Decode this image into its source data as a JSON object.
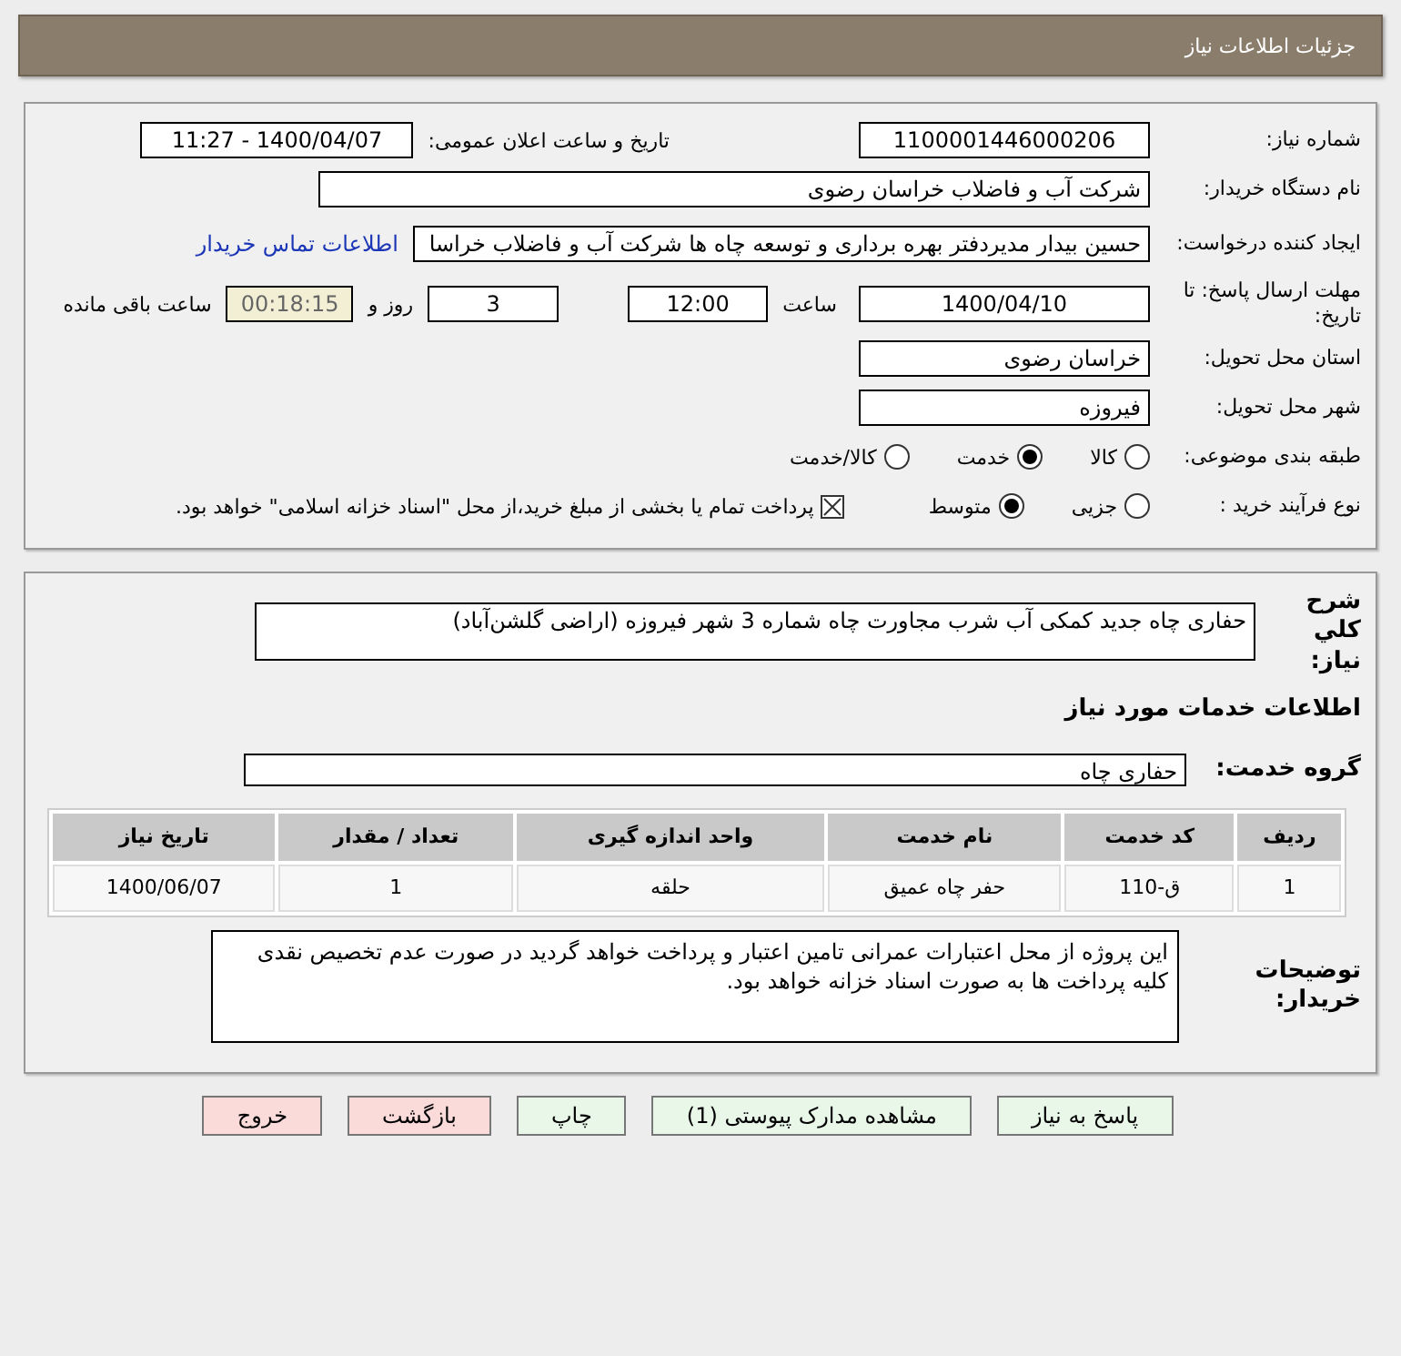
{
  "header": {
    "title": "جزئیات اطلاعات نیاز"
  },
  "need": {
    "number": {
      "label": "شماره نیاز:",
      "value": "1100001446000206"
    },
    "announce": {
      "label": "تاریخ و ساعت اعلان عمومی:",
      "value": "1400/04/07 - 11:27"
    },
    "buyer": {
      "label": "نام دستگاه خریدار:",
      "value": "شرکت آب و فاضلاب خراسان رضوی"
    },
    "requester": {
      "label": "ایجاد کننده درخواست:",
      "value": "حسین  بیدار مدیردفتر بهره برداری و توسعه چاه ها شرکت آب و فاضلاب خراسا",
      "link": "اطلاعات تماس خریدار"
    },
    "deadline": {
      "label": "مهلت ارسال پاسخ: تا تاریخ:",
      "date": "1400/04/10",
      "time_label": "ساعت",
      "time": "12:00",
      "days": "3",
      "days_label": "روز و",
      "remaining": "00:18:15",
      "remaining_label": "ساعت باقی مانده"
    },
    "province": {
      "label": "استان محل تحویل:",
      "value": "خراسان رضوی"
    },
    "city": {
      "label": "شهر محل تحویل:",
      "value": "فیروزه"
    },
    "category": {
      "label": "طبقه بندی موضوعی:",
      "options": [
        {
          "label": "کالا",
          "selected": false
        },
        {
          "label": "خدمت",
          "selected": true
        },
        {
          "label": "کالا/خدمت",
          "selected": false
        }
      ]
    },
    "process": {
      "label": "نوع فرآیند خرید :",
      "options": [
        {
          "label": "جزیی",
          "selected": false
        },
        {
          "label": "متوسط",
          "selected": true
        }
      ],
      "payment": {
        "checked": true,
        "label": "پرداخت تمام یا بخشی از مبلغ خرید،از محل \"اسناد خزانه اسلامی\" خواهد بود."
      }
    }
  },
  "details": {
    "description": {
      "label": "شرح كلي نياز:",
      "value": "حفاری چاه جدید کمکی آب شرب مجاورت چاه شماره 3 شهر فیروزه (اراضی گلشن‌آباد)"
    },
    "services_title": "اطلاعات خدمات مورد نیاز",
    "group": {
      "label": "گروه خدمت:",
      "value": "حفاری چاه"
    },
    "table": {
      "columns": [
        "ردیف",
        "کد خدمت",
        "نام خدمت",
        "واحد اندازه گیری",
        "تعداد / مقدار",
        "تاریخ نیاز"
      ],
      "rows": [
        [
          "1",
          "ق-110",
          "حفر چاه عمیق",
          "حلقه",
          "1",
          "1400/06/07"
        ]
      ]
    },
    "notes": {
      "label": "توضیحات خریدار:",
      "value": "این پروژه از محل اعتبارات عمرانی تامین اعتبار و پرداخت خواهد گردید در صورت عدم تخصیص نقدی کلیه پرداخت ها به صورت اسناد خزانه خواهد بود."
    }
  },
  "buttons": [
    {
      "label": "پاسخ به نیاز",
      "kind": "normal"
    },
    {
      "label": "مشاهده مدارک پیوستی (1)",
      "kind": "normal"
    },
    {
      "label": "چاپ",
      "kind": "normal"
    },
    {
      "label": "بازگشت",
      "kind": "danger"
    },
    {
      "label": "خروج",
      "kind": "danger"
    }
  ]
}
